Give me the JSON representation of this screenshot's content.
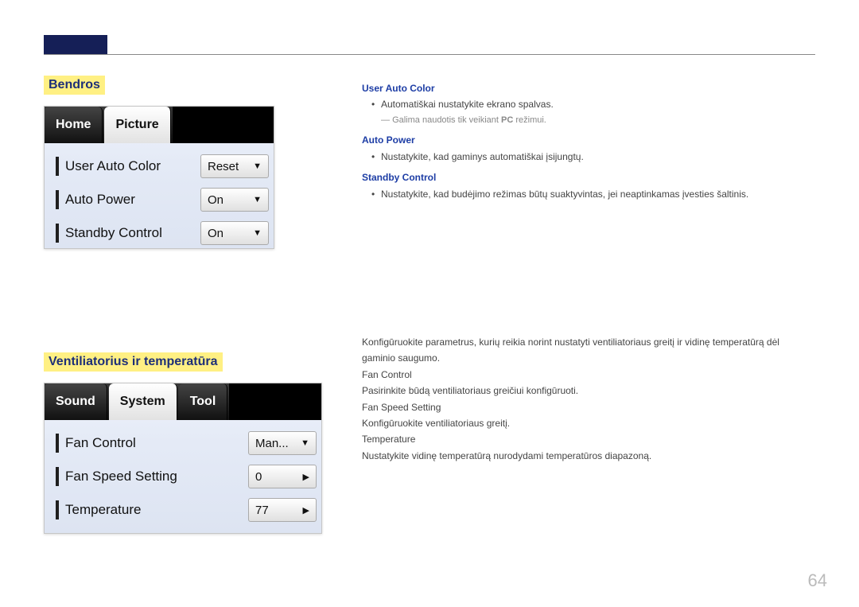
{
  "sections": {
    "general": {
      "title": "Bendros",
      "tabs": {
        "home": "Home",
        "picture": "Picture"
      },
      "rows": {
        "user_auto_color": {
          "label": "User Auto Color",
          "value": "Reset"
        },
        "auto_power": {
          "label": "Auto Power",
          "value": "On"
        },
        "standby_control": {
          "label": "Standby Control",
          "value": "On"
        }
      }
    },
    "fan_temp": {
      "title": "Ventiliatorius ir temperatūra",
      "tabs": {
        "sound": "Sound",
        "system": "System",
        "tool": "Tool"
      },
      "rows": {
        "fan_control": {
          "label": "Fan Control",
          "value": "Man..."
        },
        "fan_speed": {
          "label": "Fan Speed Setting",
          "value": "0"
        },
        "temperature": {
          "label": "Temperature",
          "value": "77"
        }
      }
    }
  },
  "right1": {
    "h_uac": "User Auto Color",
    "b_uac": "Automatiškai nustatykite ekrano spalvas.",
    "note_uac_pre": "Galima naudotis tik veikiant ",
    "note_uac_bold": "PC",
    "note_uac_post": " režimui.",
    "h_ap": "Auto Power",
    "b_ap": "Nustatykite, kad gaminys automatiškai įsijungtų.",
    "h_sc": "Standby Control",
    "b_sc": "Nustatykite, kad budėjimo režimas būtų suaktyvintas, jei neaptinkamas įvesties šaltinis."
  },
  "right2": {
    "intro": "Konfigūruokite parametrus, kurių reikia norint nustatyti ventiliatoriaus greitį ir vidinę temperatūrą dėl gaminio saugumo.",
    "h_fc": "Fan Control",
    "b_fc": "Pasirinkite būdą ventiliatoriaus greičiui konfigūruoti.",
    "h_fs": "Fan Speed Setting",
    "b_fs": "Konfigūruokite ventiliatoriaus greitį.",
    "h_t": "Temperature",
    "b_t": "Nustatykite vidinę temperatūrą nurodydami temperatūros diapazoną."
  },
  "page": "64"
}
